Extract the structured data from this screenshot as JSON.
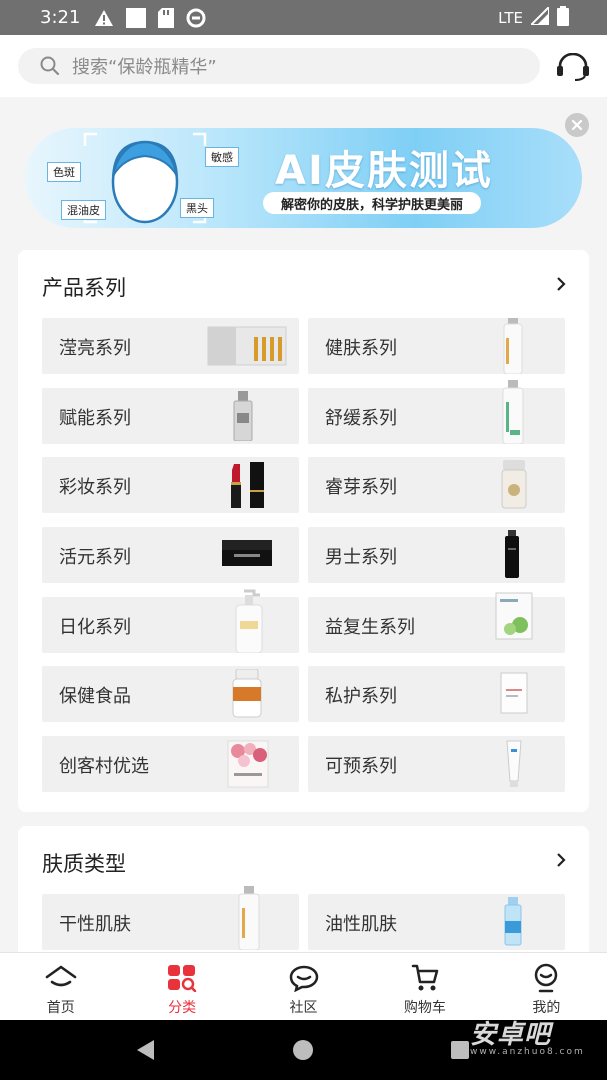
{
  "status_bar": {
    "time": "3:21",
    "network": "LTE"
  },
  "search": {
    "placeholder": "搜索“保龄瓶精华”"
  },
  "banner": {
    "title": "AI皮肤测试",
    "subtitle": "解密你的皮肤，科学护肤更美丽",
    "tags": [
      "色斑",
      "敏感",
      "混油皮",
      "黑头"
    ]
  },
  "product_series": {
    "title": "产品系列",
    "items": [
      {
        "label": "滢亮系列",
        "icon": "ampoule-box-image"
      },
      {
        "label": "健肤系列",
        "icon": "spray-bottle-image"
      },
      {
        "label": "赋能系列",
        "icon": "serum-bottle-image"
      },
      {
        "label": "舒缓系列",
        "icon": "spray-bottle-image"
      },
      {
        "label": "彩妆系列",
        "icon": "lipstick-image"
      },
      {
        "label": "睿芽系列",
        "icon": "cream-jar-image"
      },
      {
        "label": "活元系列",
        "icon": "black-jar-image"
      },
      {
        "label": "男士系列",
        "icon": "black-bottle-image"
      },
      {
        "label": "日化系列",
        "icon": "pump-bottle-image"
      },
      {
        "label": "益复生系列",
        "icon": "product-box-image"
      },
      {
        "label": "保健食品",
        "icon": "supplement-bottle-image"
      },
      {
        "label": "私护系列",
        "icon": "white-box-image"
      },
      {
        "label": "创客村优选",
        "icon": "flower-box-image"
      },
      {
        "label": "可预系列",
        "icon": "tube-image"
      }
    ]
  },
  "skin_types": {
    "title": "肤质类型",
    "items": [
      {
        "label": "干性肌肤",
        "icon": "spray-bottle-image"
      },
      {
        "label": "油性肌肤",
        "icon": "blue-bottle-image"
      }
    ]
  },
  "bottom_nav": {
    "items": [
      {
        "label": "首页",
        "icon": "home-icon"
      },
      {
        "label": "分类",
        "icon": "category-icon",
        "active": true
      },
      {
        "label": "社区",
        "icon": "community-icon"
      },
      {
        "label": "购物车",
        "icon": "cart-icon"
      },
      {
        "label": "我的",
        "icon": "profile-icon"
      }
    ]
  },
  "watermark": {
    "text": "安卓吧",
    "url_text": "www.anzhuo8.com"
  },
  "colors": {
    "accent": "#e8323c",
    "banner_blue": "#7fcff5"
  }
}
